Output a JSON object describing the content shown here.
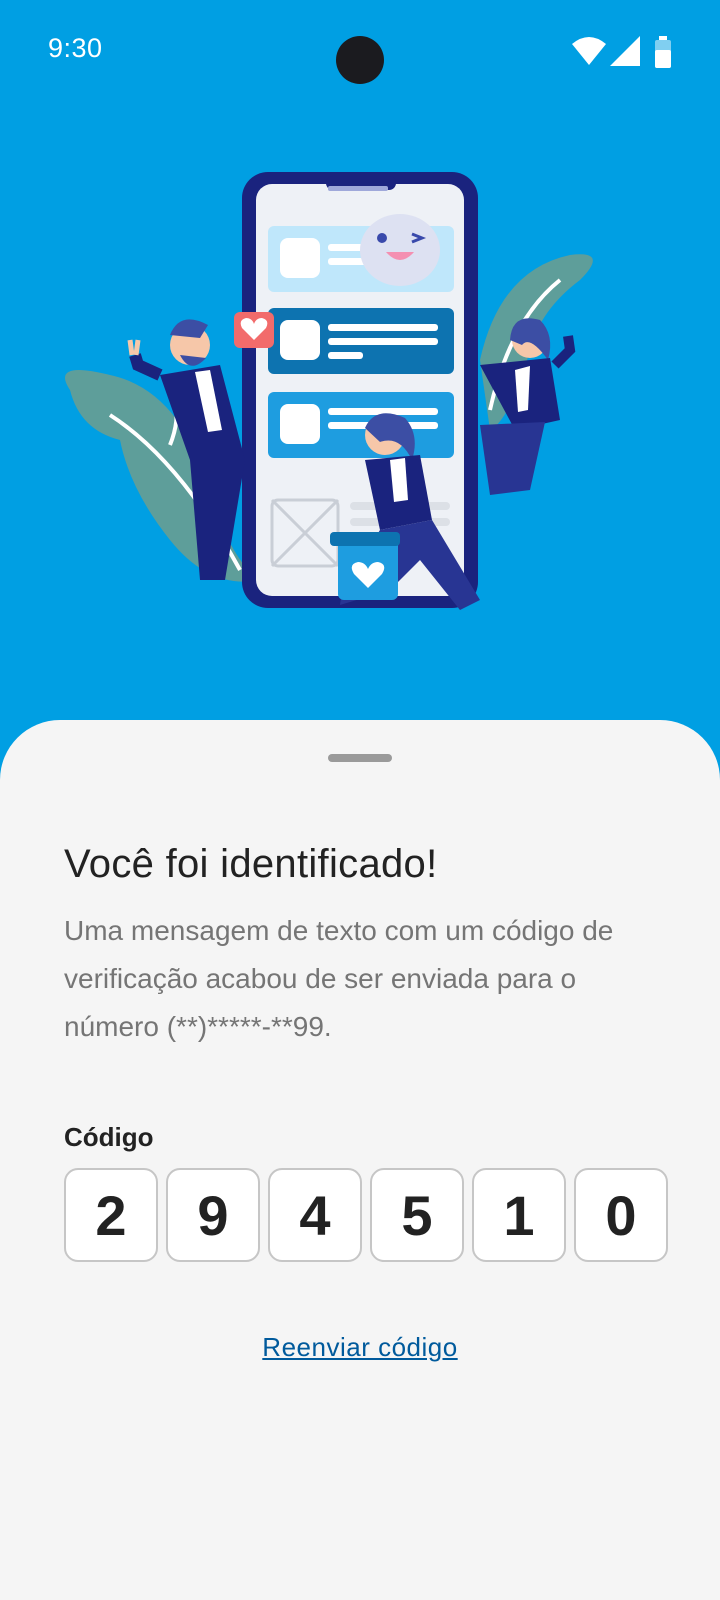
{
  "status_bar": {
    "time": "9:30",
    "icons": [
      "wifi-icon",
      "cellular-signal-icon",
      "battery-icon"
    ]
  },
  "illustration": {
    "name": "phone-with-people-illustration"
  },
  "sheet": {
    "title": "Você foi identificado!",
    "description": "Uma mensagem de texto com um código de verificação acabou de ser enviada para o número (**)*****-**99.",
    "code_label": "Código",
    "code_digits": [
      "2",
      "9",
      "4",
      "5",
      "1",
      "0"
    ],
    "resend_label": "Reenviar código"
  },
  "colors": {
    "background_top": "#009FE3",
    "sheet_background": "#F5F5F5",
    "link": "#005A9C",
    "title_text": "#222222",
    "body_text": "#757575"
  }
}
